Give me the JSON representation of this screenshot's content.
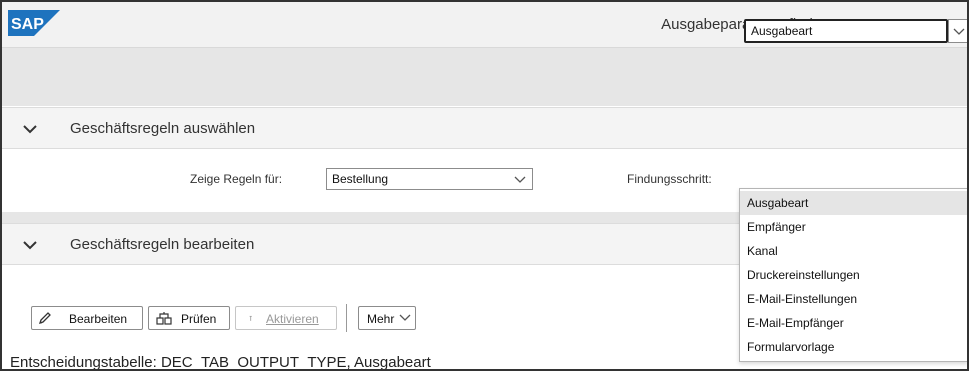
{
  "shell": {
    "logo_text": "SAP",
    "app_title": "Ausgabeparameterfindung"
  },
  "section_select": {
    "title": "Geschäftsregeln auswählen",
    "show_rules_label": "Zeige Regeln für:",
    "show_rules_value": "Bestellung",
    "step_label": "Findungsschritt:",
    "step_value": "Ausgabeart"
  },
  "dropdown": {
    "options": [
      "Ausgabeart",
      "Empfänger",
      "Kanal",
      "Druckereinstellungen",
      "E-Mail-Einstellungen",
      "E-Mail-Empfänger",
      "Formularvorlage"
    ],
    "selected_index": 0
  },
  "section_edit": {
    "title": "Geschäftsregeln bearbeiten"
  },
  "toolbar": {
    "edit_label": "Bearbeiten",
    "check_label": "Prüfen",
    "activate_label": "Aktivieren",
    "more_label": "Mehr"
  },
  "decision_table": {
    "label": "Entscheidungstabelle: DEC_TAB_OUTPUT_TYPE, Ausgabeart"
  },
  "icons": {
    "collapse": "chevron-down-icon",
    "edit": "pencil-icon",
    "check": "check-rules-icon",
    "activate": "activate-icon",
    "dropdown": "dropdown-arrow-icon"
  },
  "colors": {
    "logo_blue": "#1e73be",
    "header_bg": "#f2f2f2",
    "band_bg": "#e6e6e6",
    "selected_item_bg": "#e5e5e5"
  }
}
